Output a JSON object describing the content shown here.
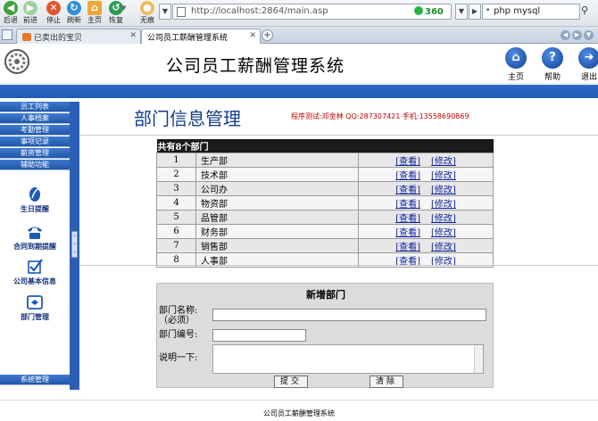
{
  "browser": {
    "toolbar": {
      "back_label": "后退",
      "forward_label": "前进",
      "stop_label": "停止",
      "refresh_label": "刷新",
      "home_label": "主页",
      "restore_label": "恢复",
      "traceless_label": "无痕"
    },
    "address": "http://localhost:2864/main.asp",
    "security_badge": "360",
    "search_query": "php mysql",
    "tabs": [
      {
        "label": "已卖出的宝贝",
        "active": false
      },
      {
        "label": "公司员工薪酬管理系统",
        "active": true
      }
    ]
  },
  "header": {
    "system_title": "公司员工薪酬管理系统",
    "buttons": [
      {
        "label": "主页",
        "icon": "home-icon",
        "color": "#2a67c9"
      },
      {
        "label": "帮助",
        "icon": "help-icon",
        "color": "#2a67c9"
      },
      {
        "label": "退出",
        "icon": "exit-icon",
        "color": "#2a67c9"
      }
    ]
  },
  "sidebar": {
    "menu_top": [
      "员工列表",
      "人事档案",
      "考勤管理",
      "事项记录",
      "薪资管理",
      "辅助功能"
    ],
    "functions": [
      {
        "label": "生日提醒",
        "icon": "birthday-icon"
      },
      {
        "label": "合同到期提醒",
        "icon": "phone-icon"
      },
      {
        "label": "公司基本信息",
        "icon": "checkbox-icon"
      },
      {
        "label": "部门管理",
        "icon": "department-icon"
      }
    ],
    "menu_bottom": "系统管理"
  },
  "main": {
    "heading": "部门信息管理",
    "credit": "程序测试:邓金林 QQ:287307421 手机:13558690869",
    "table_header": "共有8个部门",
    "view_label": "[查看]",
    "edit_label": "[修改]",
    "departments": [
      {
        "no": "1",
        "name": "生产部"
      },
      {
        "no": "2",
        "name": "技术部"
      },
      {
        "no": "3",
        "name": "公司办"
      },
      {
        "no": "4",
        "name": "物资部"
      },
      {
        "no": "5",
        "name": "品管部"
      },
      {
        "no": "6",
        "name": "财务部"
      },
      {
        "no": "7",
        "name": "销售部"
      },
      {
        "no": "8",
        "name": "人事部"
      }
    ]
  },
  "form": {
    "title": "新增部门",
    "name_label": "部门名称:",
    "name_required": "（必须）",
    "name_value": "",
    "code_label": "部门编号:",
    "code_value": "",
    "desc_label": "说明一下:",
    "desc_value": "",
    "submit_label": "提交",
    "reset_label": "清除"
  },
  "footer": {
    "text": "公司员工薪酬管理系统"
  },
  "colors": {
    "accent_blue": "#2a5fb5",
    "heading_blue": "#123c8e",
    "credit_red": "#c00000"
  }
}
